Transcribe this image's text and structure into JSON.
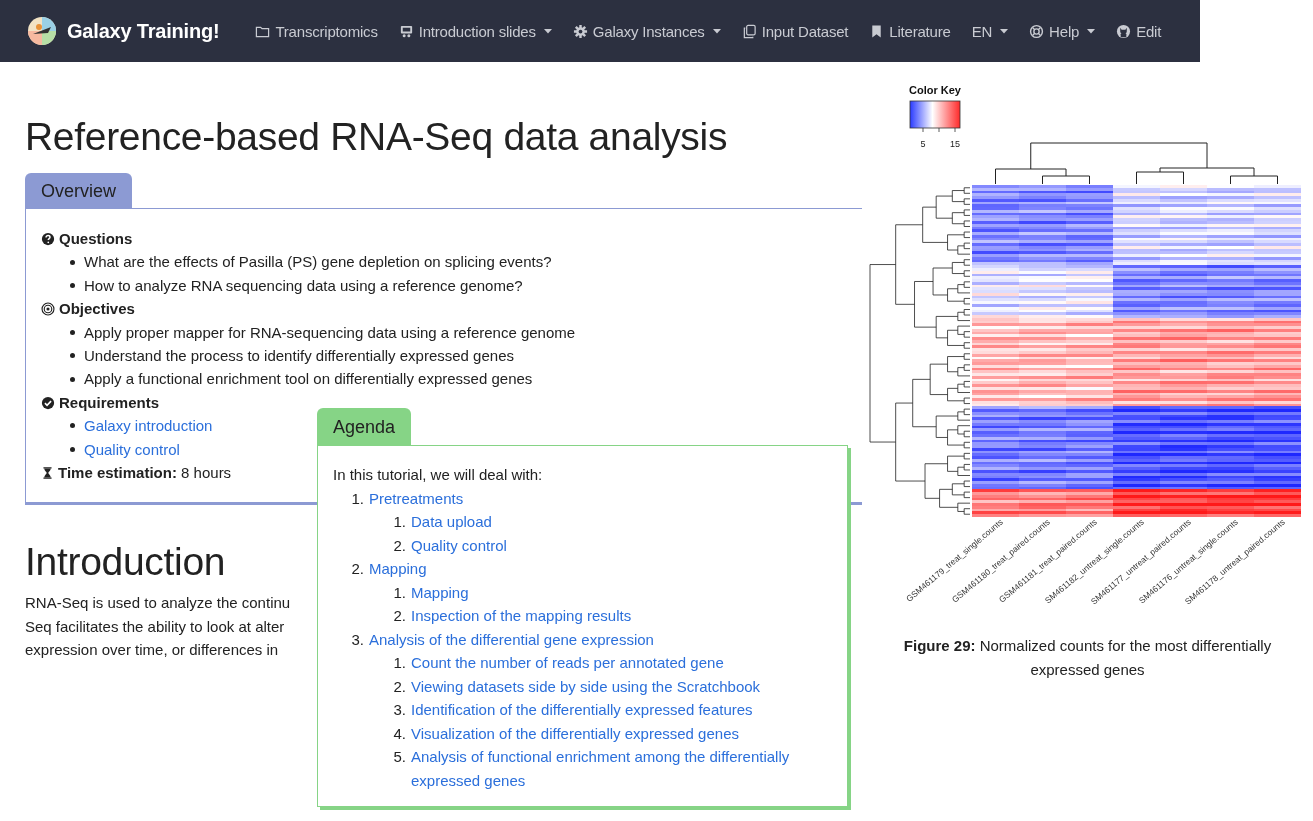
{
  "navbar": {
    "brand": "Galaxy Training!",
    "items": [
      {
        "label": "Transcriptomics",
        "dropdown": false
      },
      {
        "label": "Introduction slides",
        "dropdown": true
      },
      {
        "label": "Galaxy Instances",
        "dropdown": true
      },
      {
        "label": "Input Dataset",
        "dropdown": false
      },
      {
        "label": "Literature",
        "dropdown": false
      },
      {
        "label": "EN",
        "dropdown": true
      },
      {
        "label": "Help",
        "dropdown": true
      },
      {
        "label": "Edit",
        "dropdown": false
      }
    ]
  },
  "title": "Reference-based RNA-Seq data analysis",
  "overview": {
    "tab": "Overview",
    "sections": [
      {
        "kind": "questions",
        "heading": "Questions",
        "items": [
          {
            "text": "What are the effects of Pasilla (PS) gene depletion on splicing events?",
            "link": false
          },
          {
            "text": "How to analyze RNA sequencing data using a reference genome?",
            "link": false
          }
        ]
      },
      {
        "kind": "objectives",
        "heading": "Objectives",
        "items": [
          {
            "text": "Apply proper mapper for RNA-sequencing data using a reference genome",
            "link": false
          },
          {
            "text": "Understand the process to identify differentially expressed genes",
            "link": false
          },
          {
            "text": "Apply a functional enrichment tool on differentially expressed genes",
            "link": false
          }
        ]
      },
      {
        "kind": "requirements",
        "heading": "Requirements",
        "items": [
          {
            "text": "Galaxy introduction",
            "link": true
          },
          {
            "text": "Quality control",
            "link": true
          }
        ]
      }
    ],
    "time": "**Time estimation:** 8 hours"
  },
  "introduction": {
    "heading": "Introduction",
    "lines": [
      "RNA-Seq is used to analyze the continu",
      "Seq facilitates the ability to look at alter",
      "expression over time, or differences in"
    ]
  },
  "agenda": {
    "tab": "Agenda",
    "intro": "In this tutorial, we will deal with:",
    "items": [
      {
        "number": "1.",
        "label": "Pretreatments",
        "children": [
          {
            "number": "1.",
            "label": "Data upload"
          },
          {
            "number": "2.",
            "label": "Quality control"
          }
        ]
      },
      {
        "number": "2.",
        "label": "Mapping",
        "children": [
          {
            "number": "1.",
            "label": "Mapping"
          },
          {
            "number": "2.",
            "label": "Inspection of the mapping results"
          }
        ]
      },
      {
        "number": "3.",
        "label": "Analysis of the differential gene expression",
        "children": [
          {
            "number": "1.",
            "label": "Count the number of reads per annotated gene"
          },
          {
            "number": "2.",
            "label": "Viewing datasets side by side using the Scratchbook"
          },
          {
            "number": "3.",
            "label": "Identification of the differentially expressed features"
          },
          {
            "number": "4.",
            "label": "Visualization of the differentially expressed genes"
          },
          {
            "number": "5.",
            "label": "Analysis of functional enrichment among the differentially expressed genes"
          }
        ]
      }
    ]
  },
  "figure": {
    "color_key": {
      "title": "Color Key",
      "ticks": [
        "5",
        "15"
      ]
    },
    "column_labels": [
      "GSM461179_treat_single.counts",
      "GSM461180_treat_paired.counts",
      "GSM461181_treat_paired.counts",
      "SM461182_untreat_single.counts",
      "SM461177_untreat_paired.counts",
      "SM461176_untreat_single.counts",
      "SM461178_untreat_paired.counts"
    ],
    "caption": "**Figure 29:** Normalized counts for the most differentially expressed genes"
  }
}
